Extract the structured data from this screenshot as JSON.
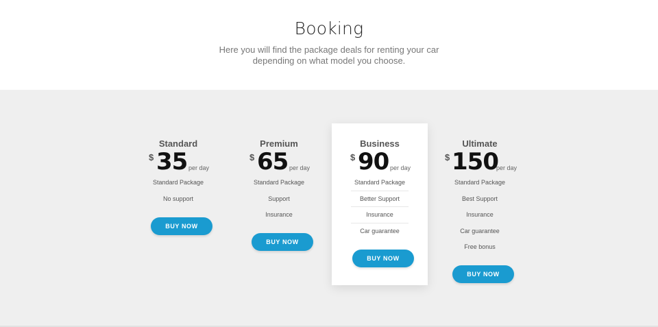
{
  "header": {
    "title": "Booking",
    "subtitle_line1": "Here you will find the package deals for renting your car",
    "subtitle_line2": "depending on what model you choose."
  },
  "colors": {
    "accent": "#1a9bd0",
    "section_background": "#efefef",
    "card_background": "#ffffff"
  },
  "plans": [
    {
      "name": "Standard",
      "currency": "$",
      "price": "35",
      "period": "per day",
      "features": [
        "Standard Package",
        "No support",
        "",
        "",
        ""
      ],
      "button": "BUY NOW",
      "featured": false
    },
    {
      "name": "Premium",
      "currency": "$",
      "price": "65",
      "period": "per day",
      "features": [
        "Standard Package",
        "Support",
        "Insurance",
        "",
        ""
      ],
      "button": "BUY NOW",
      "featured": false
    },
    {
      "name": "Business",
      "currency": "$",
      "price": "90",
      "period": "per day",
      "features": [
        "Standard Package",
        "Better Support",
        "Insurance",
        "Car guarantee",
        ""
      ],
      "button": "BUY NOW",
      "featured": true
    },
    {
      "name": "Ultimate",
      "currency": "$",
      "price": "150",
      "period": "per day",
      "features": [
        "Standard Package",
        "Best Support",
        "Insurance",
        "Car guarantee",
        "Free bonus"
      ],
      "button": "BUY NOW",
      "featured": false
    }
  ]
}
